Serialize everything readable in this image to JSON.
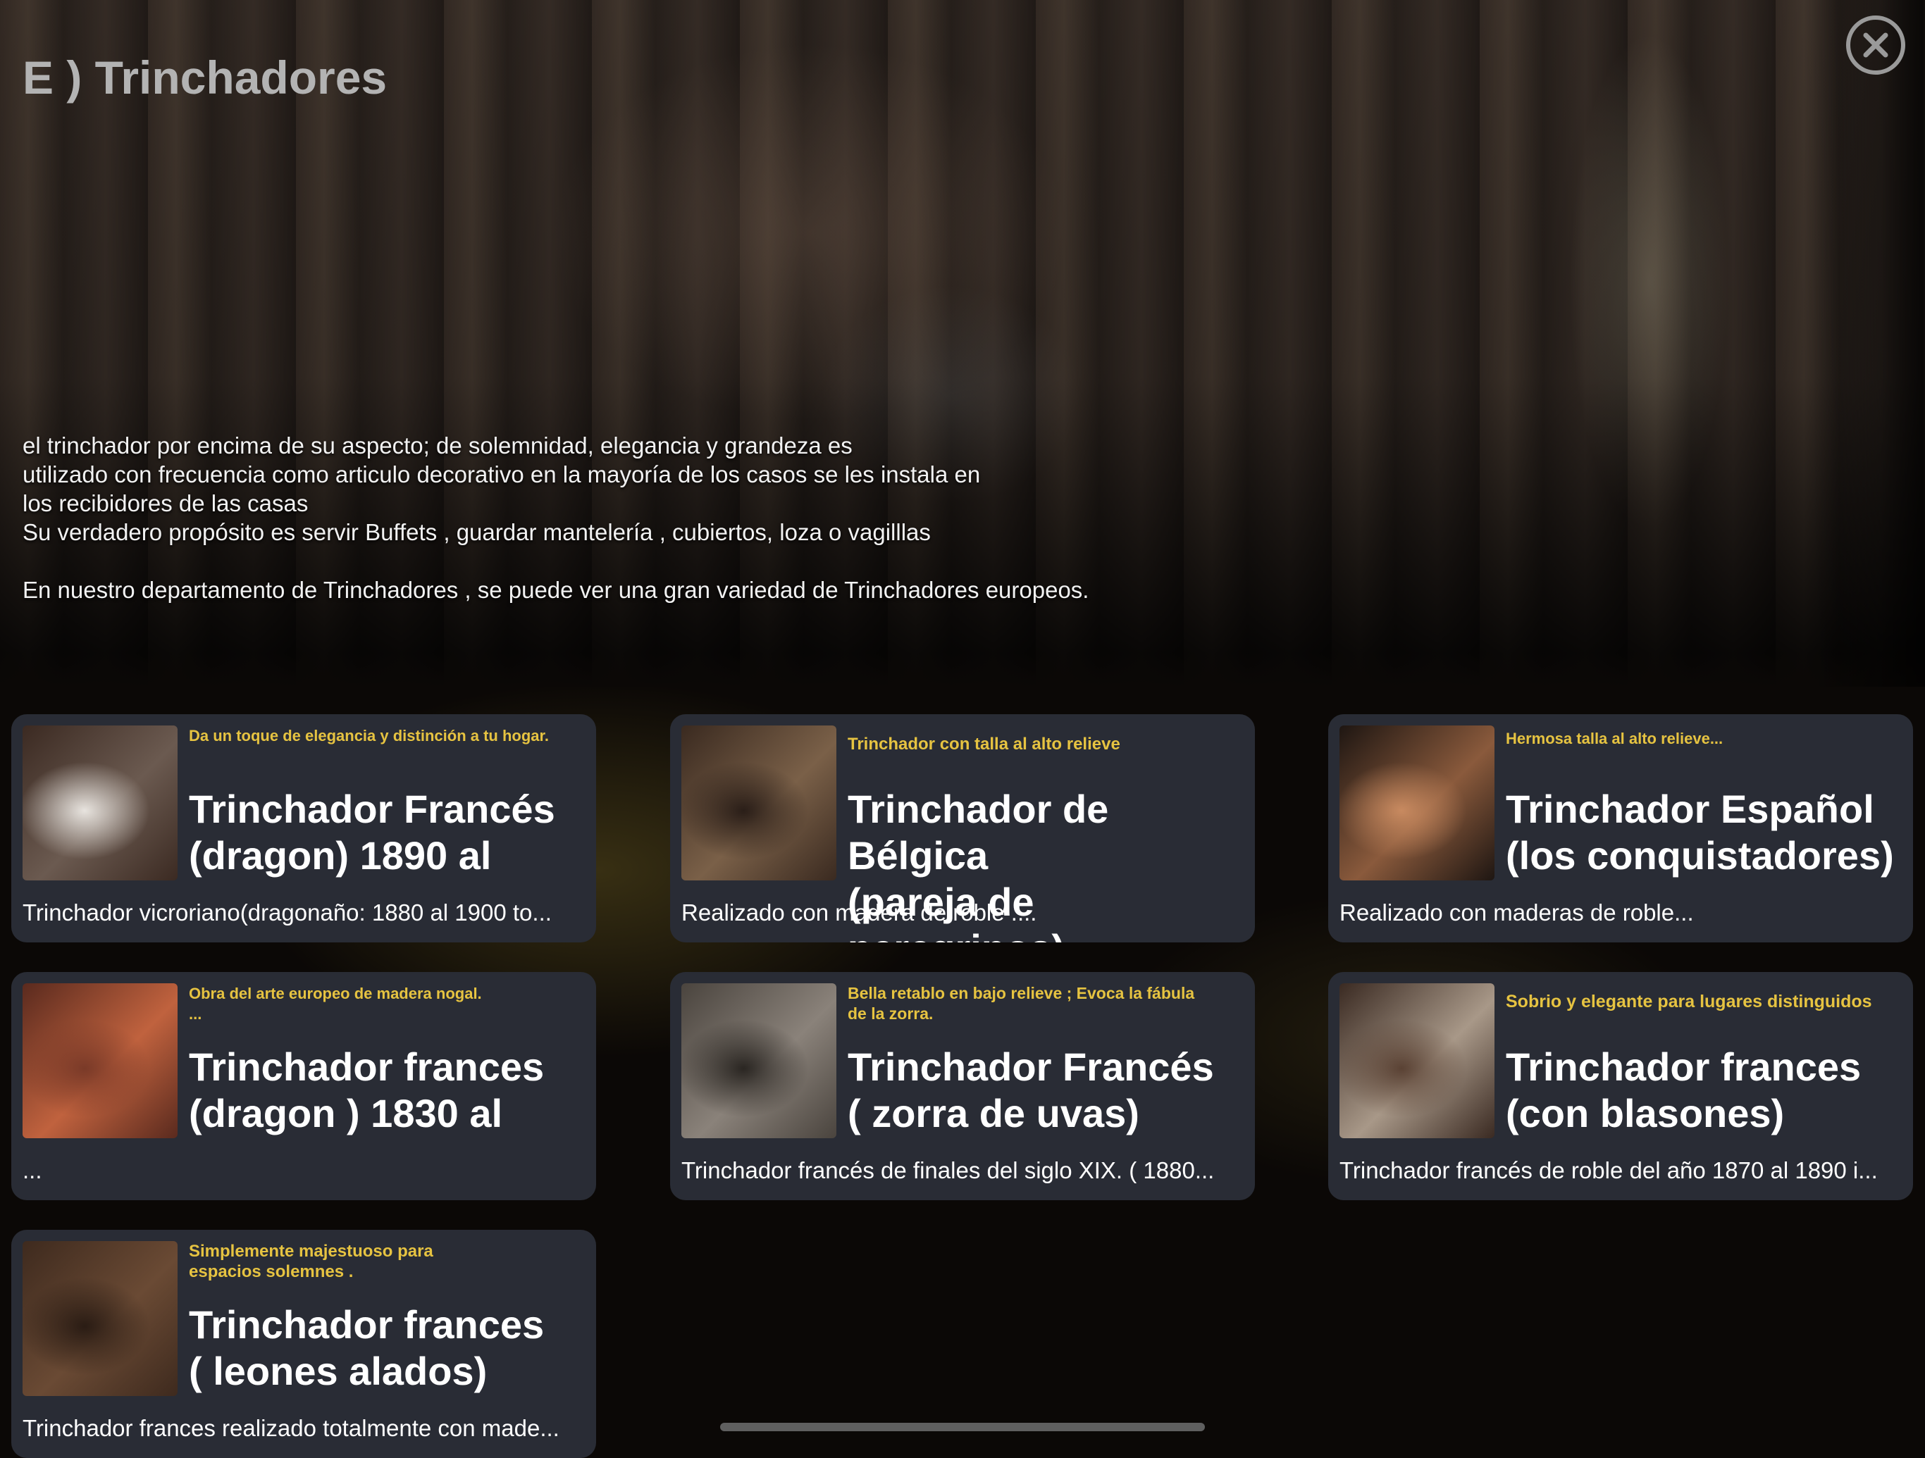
{
  "page": {
    "title": "E ) Trinchadores",
    "close_icon": "close-circle-icon"
  },
  "intro": {
    "lines": [
      "el trinchador por encima de su aspecto; de solemnidad, elegancia y grandeza es",
      "utilizado con frecuencia como articulo decorativo en la mayoría de los casos se les instala en",
      "los recibidores de las casas",
      "Su verdadero propósito es servir Buffets , guardar mantelería , cubiertos, loza o vagilllas"
    ],
    "footer": "En nuestro departamento de Trinchadores , se puede ver una gran variedad de Trinchadores europeos."
  },
  "cards": [
    {
      "tag": "Da un toque de elegancia y distinción a tu hogar.",
      "title": "Trinchador Francés\n(dragon) 1890 al",
      "description": "Trinchador  vicroriano(dragonaño: 1880 al 1900 to...",
      "thumb_colors": [
        "#3b2a22",
        "#6b5a50",
        "#e8e4df"
      ]
    },
    {
      "tag": "Trinchador con talla  al alto relieve",
      "title": "Trinchador de Bélgica\n(pareja de peregrinos)",
      "description": "Realizado con madera de roble ....",
      "thumb_colors": [
        "#3a2a20",
        "#7a6048",
        "#2a1e18"
      ]
    },
    {
      "tag": "Hermosa talla al alto relieve...",
      "title": "Trinchador Español\n(los conquistadores)",
      "description": "Realizado con maderas de roble...",
      "thumb_colors": [
        "#1e1612",
        "#8a5a3c",
        "#c88a60"
      ]
    },
    {
      "tag": "Obra del arte europeo de  madera nogal.\n...",
      "title": "Trinchador frances\n(dragon )  1830 al",
      "description": "...",
      "thumb_colors": [
        "#5a2a1e",
        "#c0623e",
        "#7a3a28"
      ]
    },
    {
      "tag": " Bella retablo en bajo relieve ;  Evoca la fábula\nde la zorra.",
      "title": "Trinchador Francés\n( zorra de uvas)",
      "description": "Trinchador francés de finales del siglo XIX. ( 1880...",
      "thumb_colors": [
        "#4a443e",
        "#8a827a",
        "#2a2622"
      ]
    },
    {
      "tag": "Sobrio y elegante para lugares distinguidos",
      "title": "Trinchador frances\n(con blasones)",
      "description": "Trinchador francés de roble del año 1870 al 1890 i...",
      "thumb_colors": [
        "#3a2a22",
        "#a89888",
        "#5a4234"
      ]
    },
    {
      "tag": "Simplemente majestuoso para\nespacios solemnes .",
      "title": "Trinchador frances\n( leones alados)",
      "description": "Trinchador frances realizado totalmente con made...",
      "thumb_colors": [
        "#3e2a1e",
        "#6a4a34",
        "#2a1c14"
      ]
    }
  ]
}
